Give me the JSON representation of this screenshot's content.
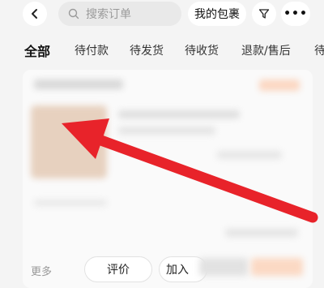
{
  "header": {
    "search_placeholder": "搜索订单",
    "packages_label": "我的包裹",
    "more_label": "•••"
  },
  "tabs": [
    {
      "label": "全部",
      "active": true
    },
    {
      "label": "待付款",
      "active": false
    },
    {
      "label": "待发货",
      "active": false
    },
    {
      "label": "待收货",
      "active": false
    },
    {
      "label": "退款/售后",
      "active": false
    },
    {
      "label": "待",
      "active": false
    }
  ],
  "order_card": {
    "more_label": "更多",
    "review_label": "评价",
    "add_label": "加入"
  },
  "colors": {
    "annotation_arrow": "#e8232a",
    "background": "#f4f4f4"
  }
}
